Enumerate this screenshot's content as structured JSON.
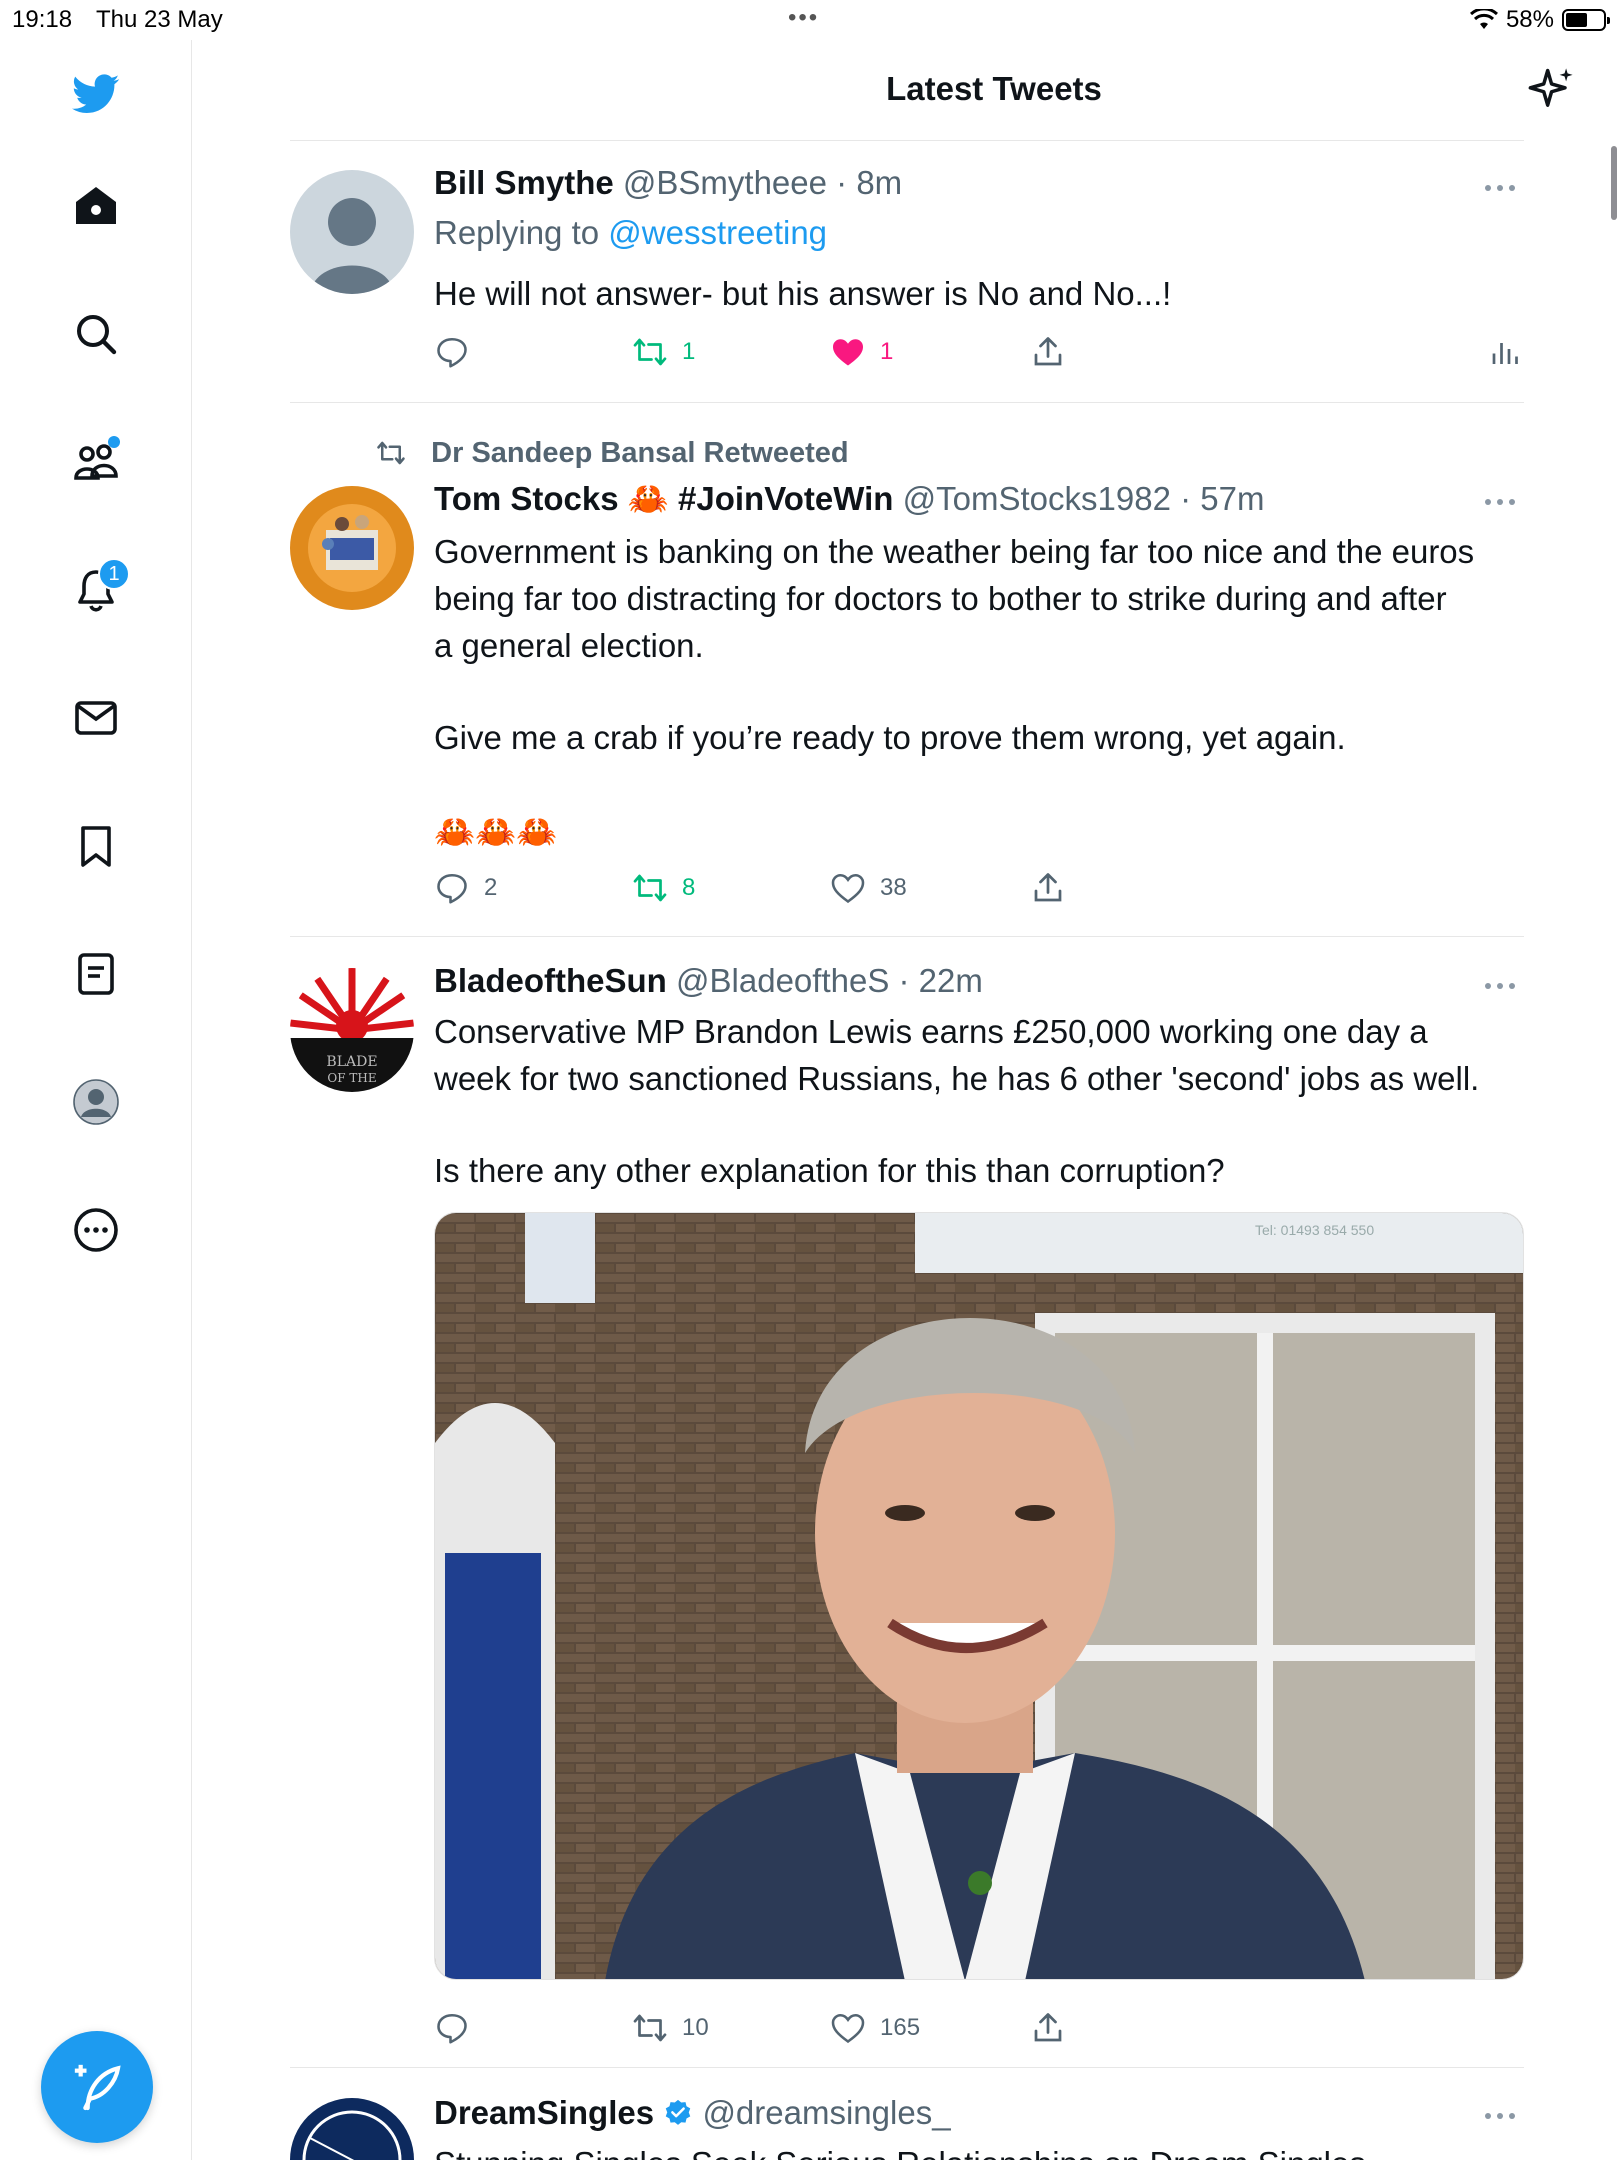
{
  "status_bar": {
    "time": "19:18",
    "date": "Thu 23 May",
    "battery": "58%",
    "battery_level": 0.58
  },
  "header": {
    "title": "Latest Tweets"
  },
  "sidebar": {
    "items": [
      {
        "name": "home",
        "icon": "home-icon"
      },
      {
        "name": "explore",
        "icon": "search-icon"
      },
      {
        "name": "communities",
        "icon": "people-icon",
        "has_dot": true
      },
      {
        "name": "notifications",
        "icon": "bell-icon",
        "badge": "1"
      },
      {
        "name": "messages",
        "icon": "envelope-icon"
      },
      {
        "name": "bookmarks",
        "icon": "bookmark-icon"
      },
      {
        "name": "lists",
        "icon": "list-icon"
      },
      {
        "name": "profile",
        "icon": "avatar-icon"
      },
      {
        "name": "more",
        "icon": "more-circle-icon"
      }
    ]
  },
  "tweets": [
    {
      "author": "Bill Smythe",
      "handle": "@BSmytheee",
      "time": "· 8m",
      "replying_to_label": "Replying to",
      "replying_to_handle": "@wesstreeting",
      "text": "He will not answer- but his answer is No and No...!",
      "replies": "",
      "retweets": "1",
      "likes": "1",
      "liked": true,
      "retweeted": true
    },
    {
      "retweeted_by": "Dr Sandeep Bansal Retweeted",
      "author": "Tom Stocks 🦀 #JoinVoteWin",
      "handle": "@TomStocks1982",
      "time": "· 57m",
      "text_lines": [
        "Government is banking on the weather being far too nice and the euros",
        "being far too distracting for doctors to bother to strike during and after",
        "a general election.",
        "",
        "Give me a crab if you’re ready to prove them wrong, yet again.",
        "",
        "🦀🦀🦀"
      ],
      "replies": "2",
      "retweets": "8",
      "likes": "38",
      "retweeted": true
    },
    {
      "author": "BladeoftheSun",
      "handle": "@BladeoftheS",
      "time": "· 22m",
      "text_lines": [
        "Conservative MP Brandon Lewis earns £250,000 working one day a",
        "week for two sanctioned Russians, he has 6 other 'second' jobs as well.",
        "",
        "Is there any other explanation for this than corruption?"
      ],
      "image_sign": "Tel: 01493 854 550",
      "replies": "",
      "retweets": "10",
      "likes": "165"
    },
    {
      "author": "DreamSingles",
      "handle": "@dreamsingles_",
      "verified": true,
      "text_partial": "Stunning Singles Seek Serious Relationships on Dream Singles"
    }
  ],
  "colors": {
    "accent": "#1d9bf0",
    "retweet_green": "#00ba7c",
    "like_pink": "#f91880",
    "muted": "#536471"
  }
}
